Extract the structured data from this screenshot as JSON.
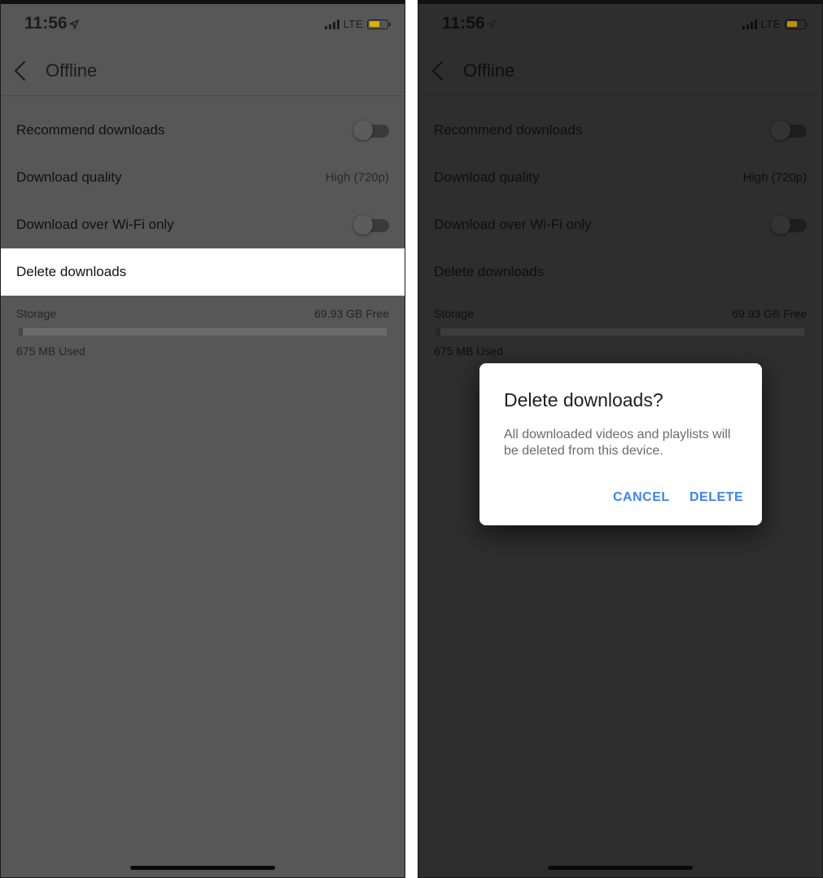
{
  "status_bar": {
    "time": "11:56",
    "network": "LTE"
  },
  "nav": {
    "title": "Offline"
  },
  "settings": {
    "recommend_downloads": {
      "label": "Recommend downloads",
      "enabled": false
    },
    "download_quality": {
      "label": "Download quality",
      "value": "High (720p)"
    },
    "wifi_only": {
      "label": "Download over Wi-Fi only",
      "enabled": false
    },
    "delete_downloads": {
      "label": "Delete downloads"
    }
  },
  "storage": {
    "label": "Storage",
    "free": "69.93 GB Free",
    "used": "675 MB Used",
    "used_fraction": 0.01
  },
  "dialog": {
    "title": "Delete downloads?",
    "message": "All downloaded videos and playlists will be deleted from this device.",
    "cancel_label": "CANCEL",
    "delete_label": "DELETE"
  },
  "colors": {
    "accent": "#3e82f7",
    "highlight": "#ffffff",
    "overlay_light": "#575757",
    "overlay_dark": "#2e2e2e"
  }
}
